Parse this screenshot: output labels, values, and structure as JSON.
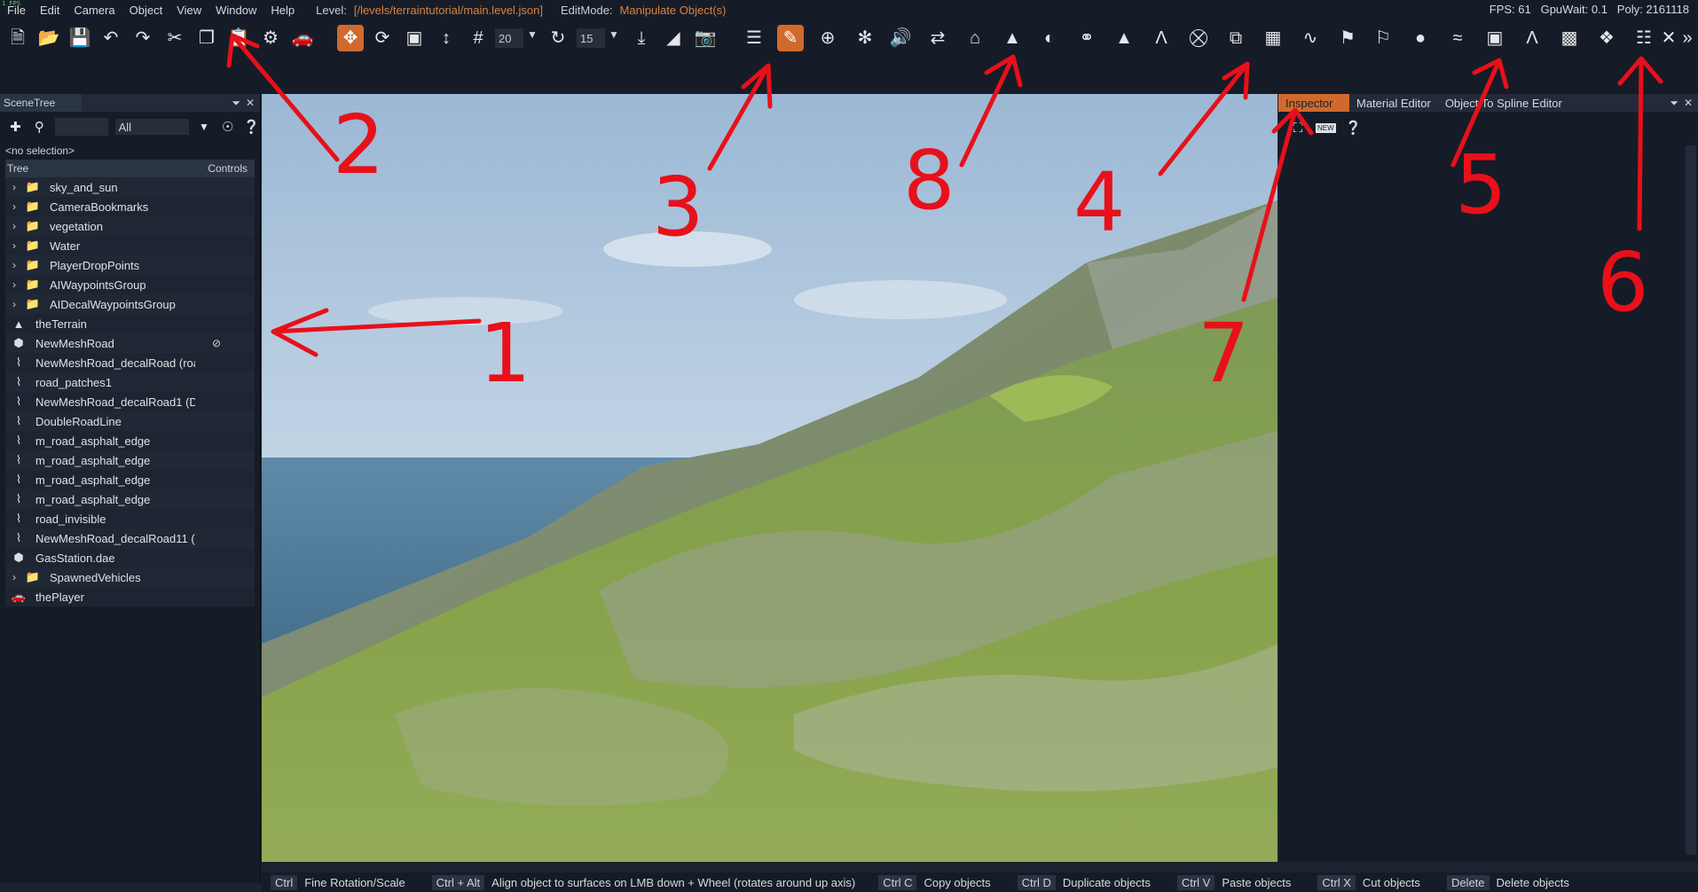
{
  "menubar": {
    "items": [
      "File",
      "Edit",
      "Camera",
      "Object",
      "View",
      "Window",
      "Help"
    ],
    "level_label": "Level:",
    "level_path": "[/levels/terraintutorial/main.level.json]",
    "editmode_label": "EditMode:",
    "editmode_value": "Manipulate Object(s)",
    "fps_tiny": "1 FPS",
    "stats": "FPS: 61   GpuWait: 0.1   Poly: 2161118"
  },
  "toolbar": {
    "grid_snap_value": "20",
    "rotation_snap_value": "15",
    "icons": [
      "new-file-icon",
      "open-folder-icon",
      "save-icon",
      "undo-icon",
      "redo-icon",
      "cut-icon",
      "copy-icon",
      "paste-icon",
      "settings-icon",
      "vehicle-icon",
      "translate-icon",
      "rotate-icon",
      "scale-icon",
      "align-icon",
      "grid-icon",
      "rotate-snap-icon",
      "terrain-snap-icon",
      "slope-icon",
      "camera-icon",
      "menu-icon",
      "pencil-edit-icon",
      "add-icon",
      "target-icon",
      "audio-icon",
      "flowgraph-icon",
      "hat-icon",
      "forest-icon",
      "paint-icon",
      "sphere-icon",
      "landmark-icon",
      "road-icon",
      "decal-road-icon",
      "brush-icon",
      "cube-icon",
      "layers-icon",
      "spline-icon",
      "flag-icon",
      "terrain-edit-icon",
      "river-icon",
      "prefab-icon",
      "mesh-road-icon",
      "building-icon",
      "nodes-icon",
      "sliders-icon",
      "snap-icon",
      "more-icon"
    ]
  },
  "scene_tree": {
    "title": "SceneTree",
    "filter_value": "All",
    "no_selection": "<no selection>",
    "col_tree": "Tree",
    "col_controls": "Controls",
    "items": [
      {
        "label": "sky_and_sun",
        "type": "group"
      },
      {
        "label": "CameraBookmarks",
        "type": "group"
      },
      {
        "label": "vegetation",
        "type": "group"
      },
      {
        "label": "Water",
        "type": "group"
      },
      {
        "label": "PlayerDropPoints",
        "type": "group"
      },
      {
        "label": "AIWaypointsGroup",
        "type": "group"
      },
      {
        "label": "AIDecalWaypointsGroup",
        "type": "group"
      },
      {
        "label": "theTerrain",
        "type": "terrain"
      },
      {
        "label": "NewMeshRoad",
        "type": "mesh",
        "hidden": true
      },
      {
        "label": "NewMeshRoad_decalRoad (roa",
        "type": "road"
      },
      {
        "label": "road_patches1",
        "type": "road"
      },
      {
        "label": "NewMeshRoad_decalRoad1 (Dc",
        "type": "road"
      },
      {
        "label": "DoubleRoadLine",
        "type": "road"
      },
      {
        "label": "m_road_asphalt_edge",
        "type": "road"
      },
      {
        "label": "m_road_asphalt_edge",
        "type": "road"
      },
      {
        "label": "m_road_asphalt_edge",
        "type": "road"
      },
      {
        "label": "m_road_asphalt_edge",
        "type": "road"
      },
      {
        "label": "road_invisible",
        "type": "road"
      },
      {
        "label": "NewMeshRoad_decalRoad11 (r",
        "type": "road"
      },
      {
        "label": "GasStation.dae",
        "type": "mesh"
      },
      {
        "label": "SpawnedVehicles",
        "type": "group"
      },
      {
        "label": "thePlayer",
        "type": "vehicle"
      }
    ]
  },
  "inspector": {
    "tabs": [
      "Inspector",
      "Material Editor",
      "Object To Spline Editor"
    ],
    "new_badge": "NEW"
  },
  "statusbar": {
    "items": [
      {
        "key": "Ctrl",
        "desc": "Fine Rotation/Scale"
      },
      {
        "key": "Ctrl + Alt",
        "desc": "Align object to surfaces on LMB down + Wheel (rotates around up axis)"
      },
      {
        "key": "Ctrl C",
        "desc": "Copy objects"
      },
      {
        "key": "Ctrl D",
        "desc": "Duplicate objects"
      },
      {
        "key": "Ctrl V",
        "desc": "Paste objects"
      },
      {
        "key": "Ctrl X",
        "desc": "Cut objects"
      },
      {
        "key": "Delete",
        "desc": "Delete objects"
      }
    ]
  },
  "annotations": [
    "1",
    "2",
    "3",
    "4",
    "5",
    "6",
    "7",
    "8"
  ],
  "colors": {
    "accent": "#d06a2c",
    "panel_bg": "#161c27",
    "annotation": "#e8101a"
  }
}
